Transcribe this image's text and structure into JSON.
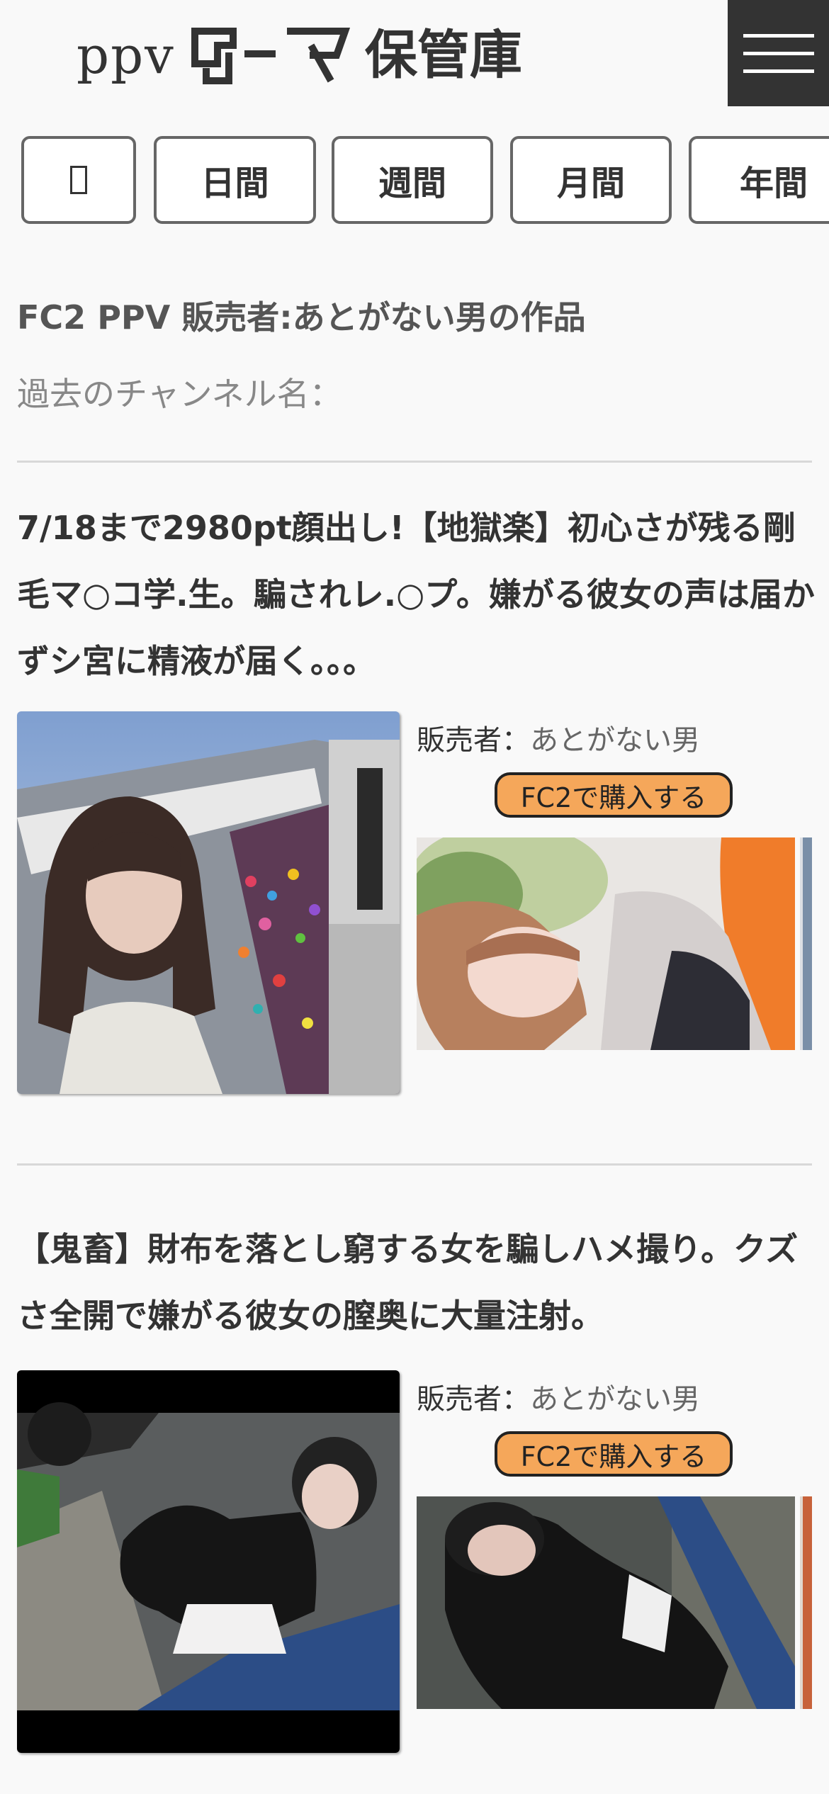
{
  "header": {
    "logo_prefix": "ppv",
    "logo_mark_name": "data-logo-mark",
    "site_title": "保管庫",
    "menu_icon": "hamburger-menu-icon"
  },
  "tabs": [
    {
      "label": "",
      "icon": "unknown-glyph-icon"
    },
    {
      "label": "日間"
    },
    {
      "label": "週間"
    },
    {
      "label": "月間"
    },
    {
      "label": "年間"
    }
  ],
  "seller": {
    "heading": "FC2 PPV 販売者:あとがない男の作品",
    "past_channel_names": "過去のチャンネル名："
  },
  "items": [
    {
      "title": "7/18まで2980pt顔出し!【地獄楽】初心さが残る剛毛マ○コ学.生。騙されレ.○プ。嫌がる彼女の声は届かずシ宮に精液が届く。。。",
      "seller_label": "販売者：",
      "seller_name": "あとがない男",
      "buy_label": "FC2で購入する"
    },
    {
      "title": "【鬼畜】財布を落とし窮する女を騙しハメ撮り。クズさ全開で嫌がる彼女の膣奥に大量注射。",
      "seller_label": "販売者：",
      "seller_name": "あとがない男",
      "buy_label": "FC2で購入する"
    }
  ],
  "colors": {
    "background": "#f9f9f9",
    "text": "#333333",
    "muted_text": "#888888",
    "buy_button": "#f5a75a",
    "menu_background": "#333333"
  }
}
